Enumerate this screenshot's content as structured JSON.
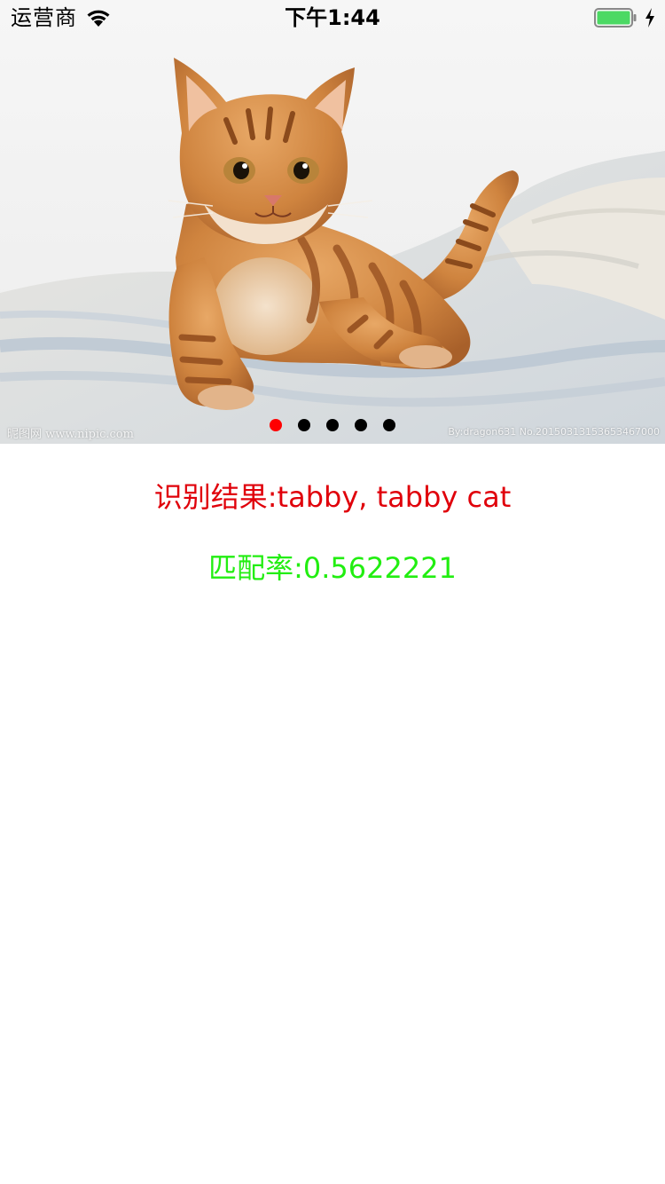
{
  "status_bar": {
    "carrier": "运营商",
    "time": "下午1:44",
    "wifi_icon": "wifi-icon",
    "battery_icon": "battery-full-icon",
    "charging_icon": "charging-bolt-icon",
    "battery_color": "#4cd964"
  },
  "carousel": {
    "image": "orange-tabby-kitten-on-blanket",
    "watermark_left": "昵图网 www.nipic.com",
    "watermark_right": "By:dragon631 No.20150313153653467000",
    "page_count": 5,
    "current_page": 1,
    "active_dot_color": "#ff0000",
    "inactive_dot_color": "#000000"
  },
  "result": {
    "recognition": "识别结果:tabby, tabby cat",
    "recognition_color": "#e0000a",
    "match_rate": "匹配率:0.5622221",
    "match_rate_color": "#22ee11"
  }
}
